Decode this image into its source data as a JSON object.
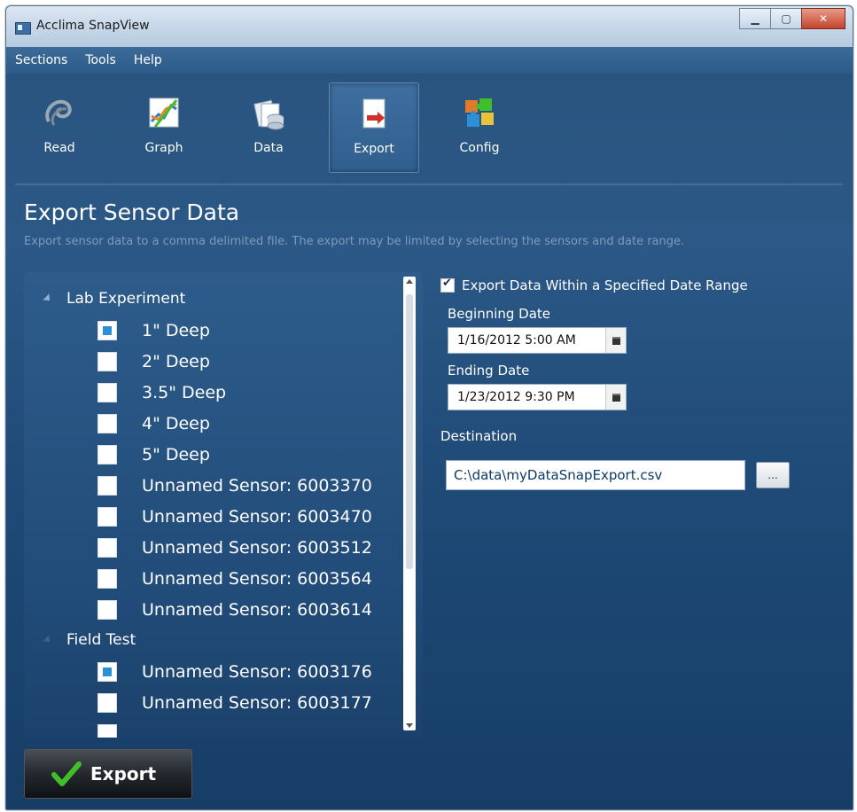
{
  "window": {
    "title": "Acclima SnapView",
    "minimize": "▁",
    "maximize": "▢",
    "close": "✕"
  },
  "menu": [
    "Sections",
    "Tools",
    "Help"
  ],
  "toolbar": [
    {
      "label": "Read",
      "icon": "read-icon"
    },
    {
      "label": "Graph",
      "icon": "graph-icon"
    },
    {
      "label": "Data",
      "icon": "data-icon"
    },
    {
      "label": "Export",
      "icon": "export-icon",
      "active": true
    },
    {
      "label": "Config",
      "icon": "config-icon"
    }
  ],
  "page": {
    "title": "Export Sensor Data",
    "description": "Export sensor data to a comma delimited file. The export may be limited by selecting the sensors and date range."
  },
  "tree": {
    "groups": [
      {
        "name": "Lab Experiment",
        "items": [
          {
            "label": "1\" Deep",
            "checked": true
          },
          {
            "label": "2\" Deep",
            "checked": false
          },
          {
            "label": "3.5\" Deep",
            "checked": false
          },
          {
            "label": "4\" Deep",
            "checked": false
          },
          {
            "label": "5\" Deep",
            "checked": false
          },
          {
            "label": "Unnamed Sensor: 6003370",
            "checked": false
          },
          {
            "label": "Unnamed Sensor: 6003470",
            "checked": false
          },
          {
            "label": "Unnamed Sensor: 6003512",
            "checked": false
          },
          {
            "label": "Unnamed Sensor: 6003564",
            "checked": false
          },
          {
            "label": "Unnamed Sensor: 6003614",
            "checked": false
          }
        ]
      },
      {
        "name": "Field Test",
        "items": [
          {
            "label": "Unnamed Sensor: 6003176",
            "checked": true
          },
          {
            "label": "Unnamed Sensor: 6003177",
            "checked": false
          }
        ]
      }
    ]
  },
  "export_options": {
    "date_range_label": "Export Data Within a Specified Date Range",
    "date_range_checked": true,
    "beginning_label": "Beginning Date",
    "beginning_value": "1/16/2012 5:00 AM",
    "ending_label": "Ending Date",
    "ending_value": "1/23/2012 9:30 PM",
    "destination_label": "Destination",
    "destination_value": "C:\\data\\myDataSnapExport.csv",
    "browse_label": "..."
  },
  "export_button": "Export",
  "colors": {
    "accent": "#2e8fd6",
    "background": "#2b5886",
    "check_green": "#3fbf2a"
  }
}
